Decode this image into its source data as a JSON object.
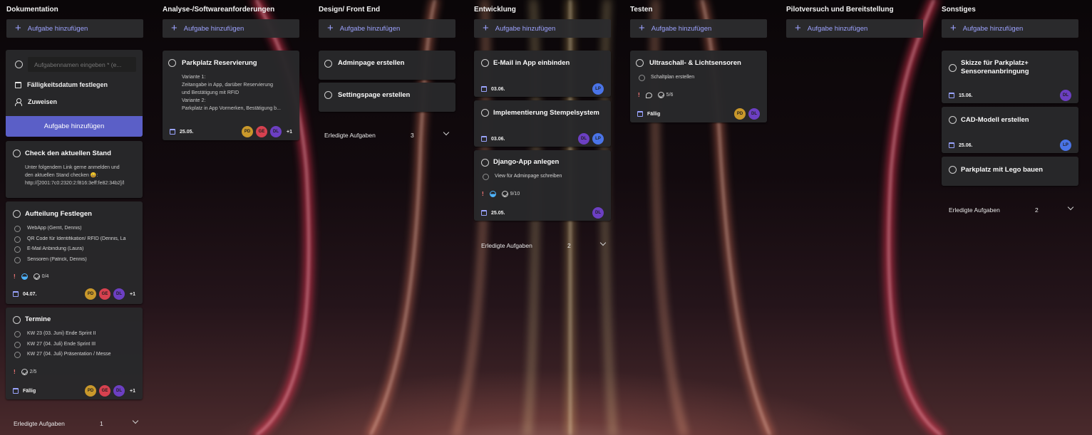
{
  "add_task_label": "Aufgabe hinzufügen",
  "done_label": "Erledigte Aufgaben",
  "new_task_form": {
    "placeholder": "Aufgabennamen eingeben * (e...",
    "due_label": "Fälligkeitsdatum festlegen",
    "assign_label": "Zuweisen",
    "submit_label": "Aufgabe hinzufügen"
  },
  "avatar_colors": {
    "PD": "#c9982b",
    "GE": "#d6414f",
    "DL": "#6c3fc2",
    "LP": "#4a74e8"
  },
  "columns": [
    {
      "title": "Dokumentation",
      "done_count": "1",
      "cards": [
        {
          "title": "Check den aktuellen Stand",
          "description": [
            "Unter folgendem Link gerne anmelden und",
            "den aktuellen Stand checken 😀:",
            "http://[2001:7c0:2320:2:f816:3eff:fe82:34b2]/l"
          ]
        },
        {
          "title": "Aufteilung Festlegen",
          "subtasks": [
            "WebApp (Gerrit, Dennis)",
            "QR Code für Identifikation/ RFID (Dennis, La",
            "E-Mail Anbindung (Laura)",
            "Sensoren (Patrick, Dennis)"
          ],
          "checklist": "0/4",
          "date": "04.07.",
          "assignees": [
            "PD",
            "GE",
            "DL"
          ],
          "more": "+1"
        },
        {
          "title": "Termine",
          "subtasks": [
            "KW 23 (03. Juni) Ende Sprint II",
            "KW 27 (04. Juli) Ende Sprint III",
            "KW 27 (04. Juli) Präsentation / Messe"
          ],
          "checklist": "2/5",
          "date": "Fällig",
          "assignees": [
            "PD",
            "GE",
            "DL"
          ],
          "more": "+1"
        }
      ]
    },
    {
      "title": "Analyse-/Softwareanforderungen",
      "cards": [
        {
          "title": "Parkplatz Reservierung",
          "description": [
            "Variante 1:",
            "Zeitangabe in App, darüber Reservierung",
            "und Bestätigung mit RFID",
            "Variante 2:",
            "Parkplatz in App Vormerken, Bestätigung b..."
          ],
          "date": "25.05.",
          "assignees": [
            "PD",
            "GE",
            "DL"
          ],
          "more": "+1"
        }
      ]
    },
    {
      "title": "Design/ Front End",
      "done_count": "3",
      "cards": [
        {
          "title": "Adminpage erstellen"
        },
        {
          "title": "Settingspage erstellen"
        }
      ]
    },
    {
      "title": "Entwicklung",
      "done_count": "2",
      "cards": [
        {
          "title": "E-Mail in App einbinden",
          "date": "03.06.",
          "assignees": [
            "LP"
          ]
        },
        {
          "title": "Implementierung Stempelsystem",
          "date": "03.06.",
          "assignees": [
            "DL",
            "LP"
          ]
        },
        {
          "title": "Django-App anlegen",
          "subtasks": [
            "View für Adminpage schreiben"
          ],
          "checklist": "9/10",
          "date": "25.05.",
          "assignees": [
            "DL"
          ]
        }
      ]
    },
    {
      "title": "Testen",
      "cards": [
        {
          "title": "Ultraschall- & Lichtsensoren",
          "subtasks": [
            "Schaltplan erstellen"
          ],
          "checklist": "5/6",
          "date": "Fällig",
          "assignees": [
            "PD",
            "DL"
          ]
        }
      ]
    },
    {
      "title": "Pilotversuch und Bereitstellung",
      "cards": []
    },
    {
      "title": "Sonstiges",
      "done_count": "2",
      "cards": [
        {
          "title": "Skizze für Parkplatz+ Sensorenanbringung",
          "date": "15.06.",
          "assignees": [
            "DL"
          ]
        },
        {
          "title": "CAD-Modell erstellen",
          "date": "25.06.",
          "assignees": [
            "LP"
          ]
        },
        {
          "title": "Parkplatz mit Lego bauen"
        }
      ]
    }
  ]
}
